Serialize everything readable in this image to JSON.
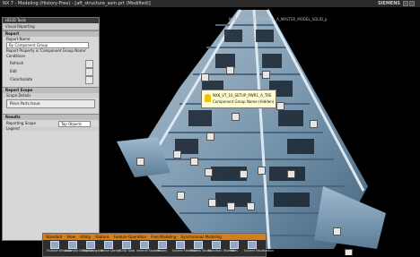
{
  "window": {
    "app_title": "NX 7 - Modeling (History-Free) - [aft_structure_asm.prt (Modified)]",
    "brand": "SIEMENS"
  },
  "viewport": {
    "part_title": "NX6_VT_10_SETUP_PWR1_A_MASTER_MODEL_SOLID_p"
  },
  "panel": {
    "title": "HD3D Tools",
    "toolbar_label": "Visual Reporting",
    "report_section": "Report",
    "report_name_label": "Report Name",
    "report_name_value": "By Component Group",
    "report_property_label": "Report Property is 'Component Group Name'",
    "conditions_label": "Conditions",
    "refresh_label": "Refresh",
    "edit_label": "Edit",
    "clear_label": "Clear/Isolate",
    "scope_section": "Report Scope",
    "scope_details": "Scope Details",
    "scope_value": "Piece Parts Issue",
    "results_section": "Results",
    "reporting_scope_label": "Reporting Scope",
    "reporting_scope_value": "Top Objects",
    "legend_label": "Legend"
  },
  "tooltip": {
    "line1": "NX6_VT_10_SETUP_PWR1_A_TRE",
    "line2": "Component Group Name (Hidden)"
  },
  "taskbar": {
    "tabs": [
      "Standard",
      "View",
      "Utility",
      "Feature",
      "Feature Operation",
      "Free Modeling",
      "Synchronous Modeling"
    ],
    "items": [
      {
        "label": "Multiple Windows",
        "icon": "windows-icon"
      },
      {
        "label": "Assembly Navigator",
        "icon": "assembly-icon"
      },
      {
        "label": "Part Navigator",
        "icon": "part-icon"
      },
      {
        "label": "Reuse Library",
        "icon": "library-icon"
      },
      {
        "label": "HD3D Tools",
        "icon": "hd3d-icon"
      },
      {
        "label": "Internet Explorer",
        "icon": "browser-icon"
      },
      {
        "label": "History",
        "icon": "history-icon"
      },
      {
        "label": "System Materials",
        "icon": "materials-icon"
      },
      {
        "label": "Process Studio",
        "icon": "process-icon"
      },
      {
        "label": "Manufact. Wizards",
        "icon": "wizard-icon"
      },
      {
        "label": "Roles",
        "icon": "roles-icon"
      },
      {
        "label": "System Visualization",
        "icon": "visualization-icon"
      }
    ]
  },
  "colors": {
    "model_blue": "#7fa2bd",
    "model_light": "#b8cfe0",
    "taskbar_tab": "#d67e1a",
    "panel_bg": "#d7d7d7"
  }
}
